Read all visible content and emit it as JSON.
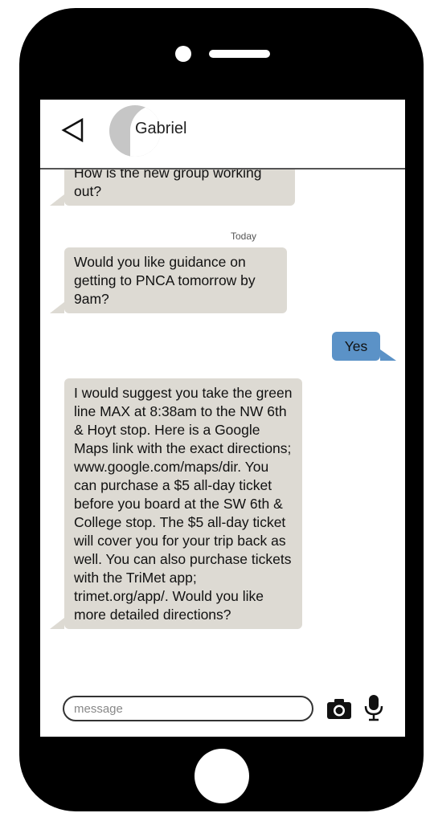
{
  "header": {
    "contact_name": "Gabriel"
  },
  "messages": [
    {
      "direction": "incoming",
      "text": "How is the new group working out?"
    },
    {
      "direction": "timestamp",
      "text": "Today"
    },
    {
      "direction": "incoming",
      "text": "Would you like guidance on getting to PNCA tomorrow by 9am?"
    },
    {
      "direction": "outgoing",
      "text": "Yes"
    },
    {
      "direction": "incoming",
      "text": "I would suggest you take the green line MAX at 8:38am to the NW 6th & Hoyt stop. Here is a Google Maps link with the exact directions; www.google.com/maps/dir. You can purchase a $5 all-day ticket before you board at the SW 6th & College stop. The $5 all-day ticket will cover you for your trip back as well. You can also purchase tickets with the TriMet app; trimet.org/app/. Would you like more detailed directions?"
    }
  ],
  "composer": {
    "placeholder": "message",
    "value": ""
  },
  "icons": {
    "back": "back-triangle-icon",
    "camera": "camera-icon",
    "mic": "microphone-icon"
  },
  "colors": {
    "incoming_bubble": "#dddad3",
    "outgoing_bubble": "#5b92c7",
    "phone_body": "#000000"
  }
}
